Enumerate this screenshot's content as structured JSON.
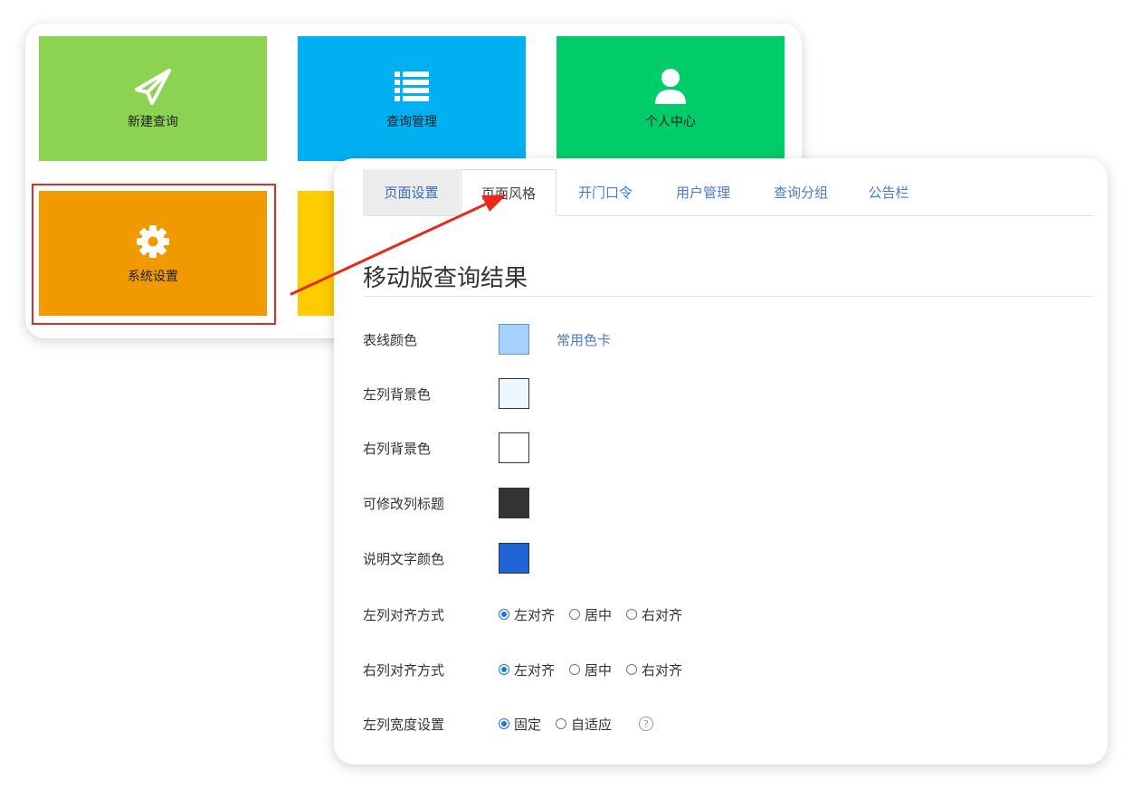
{
  "tiles": [
    {
      "label": "新建查询",
      "icon": "paper-plane-icon",
      "color": "#8cd253"
    },
    {
      "label": "查询管理",
      "icon": "list-icon",
      "color": "#00b0f0"
    },
    {
      "label": "个人中心",
      "icon": "user-icon",
      "color": "#00cc6a"
    },
    {
      "label": "系统设置",
      "icon": "gear-icon",
      "color": "#f09a00"
    },
    {
      "label": "",
      "icon": "",
      "color": "#ffcc00"
    }
  ],
  "tabs": [
    "页面设置",
    "页面风格",
    "开门口令",
    "用户管理",
    "查询分组",
    "公告栏"
  ],
  "active_tab": "页面风格",
  "section_title": "移动版查询结果",
  "color_rows": [
    {
      "label": "表线颜色",
      "color": "#a7d2ff"
    },
    {
      "label": "左列背景色",
      "color": "#eef6ff"
    },
    {
      "label": "右列背景色",
      "color": "#ffffff"
    },
    {
      "label": "可修改列标题",
      "color": "#333333"
    },
    {
      "label": "说明文字颜色",
      "color": "#1f65d6"
    }
  ],
  "color_card_link": "常用色卡",
  "align_rows": [
    {
      "label": "左列对齐方式",
      "options": [
        "左对齐",
        "居中",
        "右对齐"
      ],
      "selected": "左对齐"
    },
    {
      "label": "右列对齐方式",
      "options": [
        "左对齐",
        "居中",
        "右对齐"
      ],
      "selected": "左对齐"
    }
  ],
  "width_row": {
    "label": "左列宽度设置",
    "options": [
      "固定",
      "自适应"
    ],
    "selected": "固定",
    "help": "?"
  },
  "colors": {
    "highlight": "#e02b2b",
    "arrow": "#e8291b",
    "link": "#4a7cc7"
  }
}
